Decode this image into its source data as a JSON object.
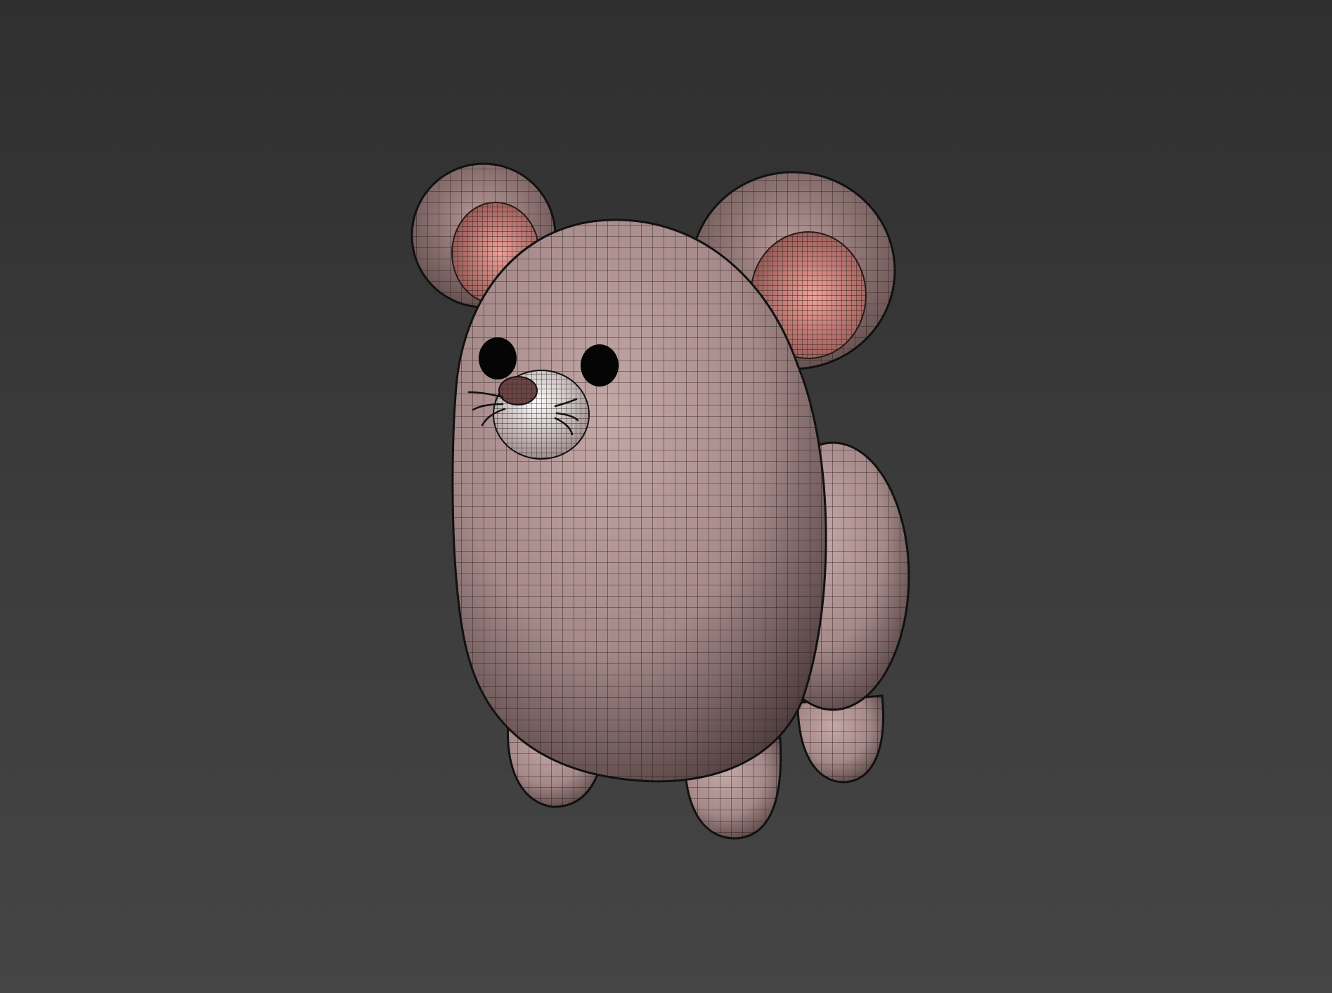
{
  "scene": {
    "subject": "mouse-model",
    "colors": {
      "background_top": "#2f2f2f",
      "background_bottom": "#454545",
      "body": "#a68a8a",
      "body_shadow": "#4a3838",
      "inner_ear": "#d28a84",
      "nose": "#6b4444",
      "eye": "#050505",
      "wire": "#1a1212"
    }
  }
}
